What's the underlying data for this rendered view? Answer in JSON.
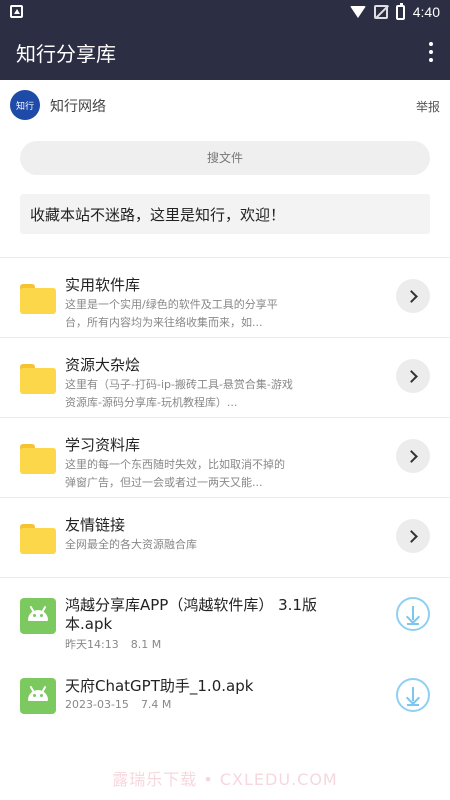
{
  "status_bar": {
    "time": "4:40",
    "icons": [
      "notification-a-icon",
      "wifi-icon",
      "no-signal-icon",
      "battery-charging-icon"
    ]
  },
  "app_bar": {
    "title": "知行分享库",
    "menu_icon": "more-vert-icon"
  },
  "publisher": {
    "logo_text": "知行",
    "name": "知行网络",
    "report_label": "举报"
  },
  "search": {
    "placeholder": "搜文件"
  },
  "notice": {
    "text": "收藏本站不迷路，这里是知行，欢迎！"
  },
  "folders": [
    {
      "title": "实用软件库",
      "desc_line1": "这里是一个实用/绿色的软件及工具的分享平",
      "desc_line2": "台，所有内容均为来往络收集而来，如..."
    },
    {
      "title": "资源大杂烩",
      "desc_line1": "这里有（马子-打码-ip-搬砖工具-悬赏合集-游戏",
      "desc_line2": "资源库-源码分享库-玩机教程库）..."
    },
    {
      "title": "学习资料库",
      "desc_line1": "这里的每一个东西随时失效，比如取消不掉的",
      "desc_line2": "弹窗广告，但过一会或者过一两天又能..."
    },
    {
      "title": "友情链接",
      "desc_line1": "全网最全的各大资源融合库",
      "desc_line2": ""
    }
  ],
  "files": [
    {
      "name": "鸿越分享库APP（鸿越软件库） 3.1版本.apk",
      "date": "昨天14:13",
      "size": "8.1 M"
    },
    {
      "name": "天府ChatGPT助手_1.0.apk",
      "date": "2023-03-15",
      "size": "7.4 M"
    }
  ],
  "watermark": "露瑞乐下载 • CXLEDU.COM",
  "colors": {
    "app_bar": "#2c2e43",
    "folder": "#fdd74a",
    "android": "#7cc95f",
    "download_accent": "#7cc6ef"
  }
}
